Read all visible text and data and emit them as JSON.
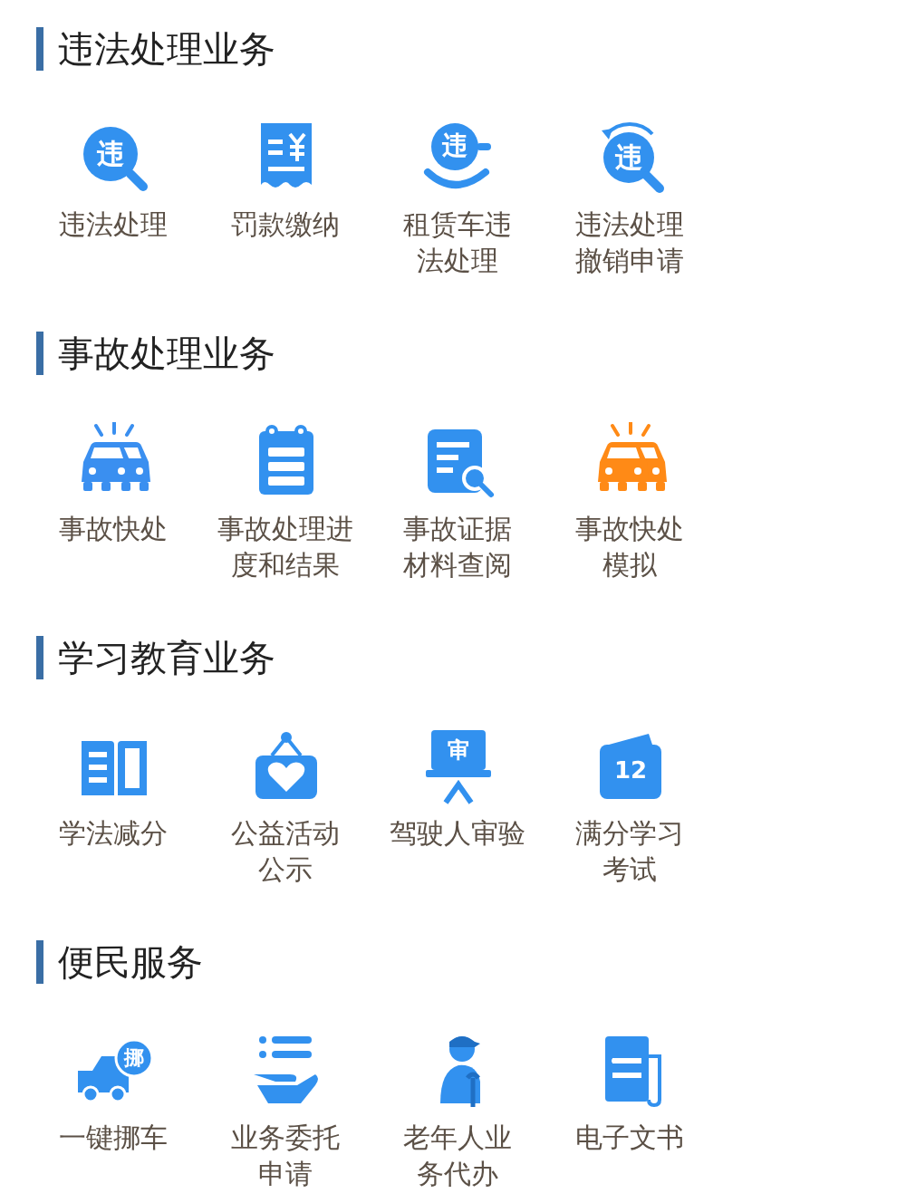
{
  "sections": [
    {
      "title": "违法处理业务",
      "items": [
        {
          "kind": "search-badge",
          "glyph": "违",
          "label_lines": [
            "违法处理"
          ]
        },
        {
          "kind": "receipt",
          "label_lines": [
            "罚款缴纳"
          ]
        },
        {
          "kind": "hand-badge",
          "glyph": "违",
          "label_lines": [
            "租赁车违",
            "法处理"
          ]
        },
        {
          "kind": "refresh-badge",
          "glyph": "违",
          "label_lines": [
            "违法处理",
            "撤销申请"
          ]
        }
      ]
    },
    {
      "title": "事故处理业务",
      "items": [
        {
          "kind": "cars",
          "color": "#3a8ff0",
          "label_lines": [
            "事故快处"
          ]
        },
        {
          "kind": "calendar-list",
          "label_lines": [
            "事故处理进",
            "度和结果"
          ]
        },
        {
          "kind": "doc-search",
          "label_lines": [
            "事故证据",
            "材料查阅"
          ]
        },
        {
          "kind": "cars",
          "color": "#ff8a16",
          "label_lines": [
            "事故快处",
            "模拟"
          ]
        }
      ]
    },
    {
      "title": "学习教育业务",
      "items": [
        {
          "kind": "book",
          "label_lines": [
            "学法减分"
          ]
        },
        {
          "kind": "heart-sign",
          "label_lines": [
            "公益活动",
            "公示"
          ]
        },
        {
          "kind": "board",
          "glyph": "审",
          "label_lines": [
            "驾驶人审验"
          ]
        },
        {
          "kind": "calendar-num",
          "glyph": "12",
          "label_lines": [
            "满分学习",
            "考试"
          ]
        }
      ]
    },
    {
      "title": "便民服务",
      "items": [
        {
          "kind": "truck",
          "glyph": "挪",
          "label_lines": [
            "一键挪车"
          ]
        },
        {
          "kind": "hand-list",
          "label_lines": [
            "业务委托",
            "申请"
          ]
        },
        {
          "kind": "elder",
          "label_lines": [
            "老年人业",
            "务代办"
          ]
        },
        {
          "kind": "document",
          "label_lines": [
            "电子文书"
          ]
        }
      ]
    }
  ]
}
